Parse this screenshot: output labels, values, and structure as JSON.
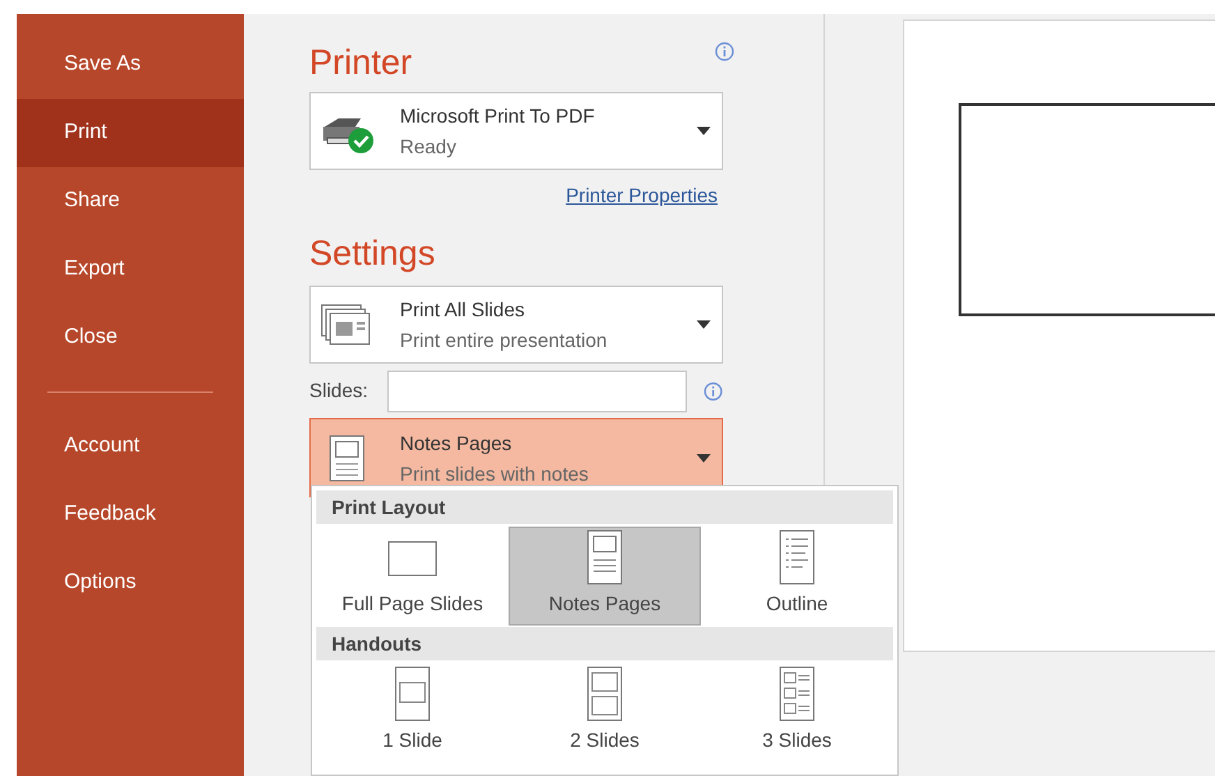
{
  "sidebar": {
    "groups": [
      {
        "items": [
          {
            "label": "Save As",
            "selected": false
          },
          {
            "label": "Print",
            "selected": true
          },
          {
            "label": "Share",
            "selected": false
          },
          {
            "label": "Export",
            "selected": false
          },
          {
            "label": "Close",
            "selected": false
          }
        ]
      },
      {
        "items": [
          {
            "label": "Account",
            "selected": false
          },
          {
            "label": "Feedback",
            "selected": false
          },
          {
            "label": "Options",
            "selected": false
          }
        ]
      }
    ]
  },
  "printer": {
    "heading": "Printer",
    "device": {
      "name": "Microsoft Print To PDF",
      "status": "Ready"
    },
    "properties_link": "Printer Properties"
  },
  "settings": {
    "heading": "Settings",
    "range": {
      "title": "Print All Slides",
      "subtitle": "Print entire presentation"
    },
    "slides_field": {
      "label": "Slides:"
    },
    "layout": {
      "title": "Notes Pages",
      "subtitle": "Print slides with notes",
      "expanded": true
    }
  },
  "layout_menu": {
    "sections": [
      {
        "heading": "Print Layout",
        "options": [
          {
            "kind": "full",
            "label": "Full Page Slides",
            "selected": false
          },
          {
            "kind": "notes",
            "label": "Notes Pages",
            "selected": true
          },
          {
            "kind": "outline",
            "label": "Outline",
            "selected": false
          }
        ]
      },
      {
        "heading": "Handouts",
        "options": [
          {
            "kind": "one",
            "label": "1 Slide",
            "selected": false
          },
          {
            "kind": "two",
            "label": "2 Slides",
            "selected": false
          },
          {
            "kind": "three",
            "label": "3 Slides",
            "selected": false
          }
        ]
      }
    ]
  }
}
